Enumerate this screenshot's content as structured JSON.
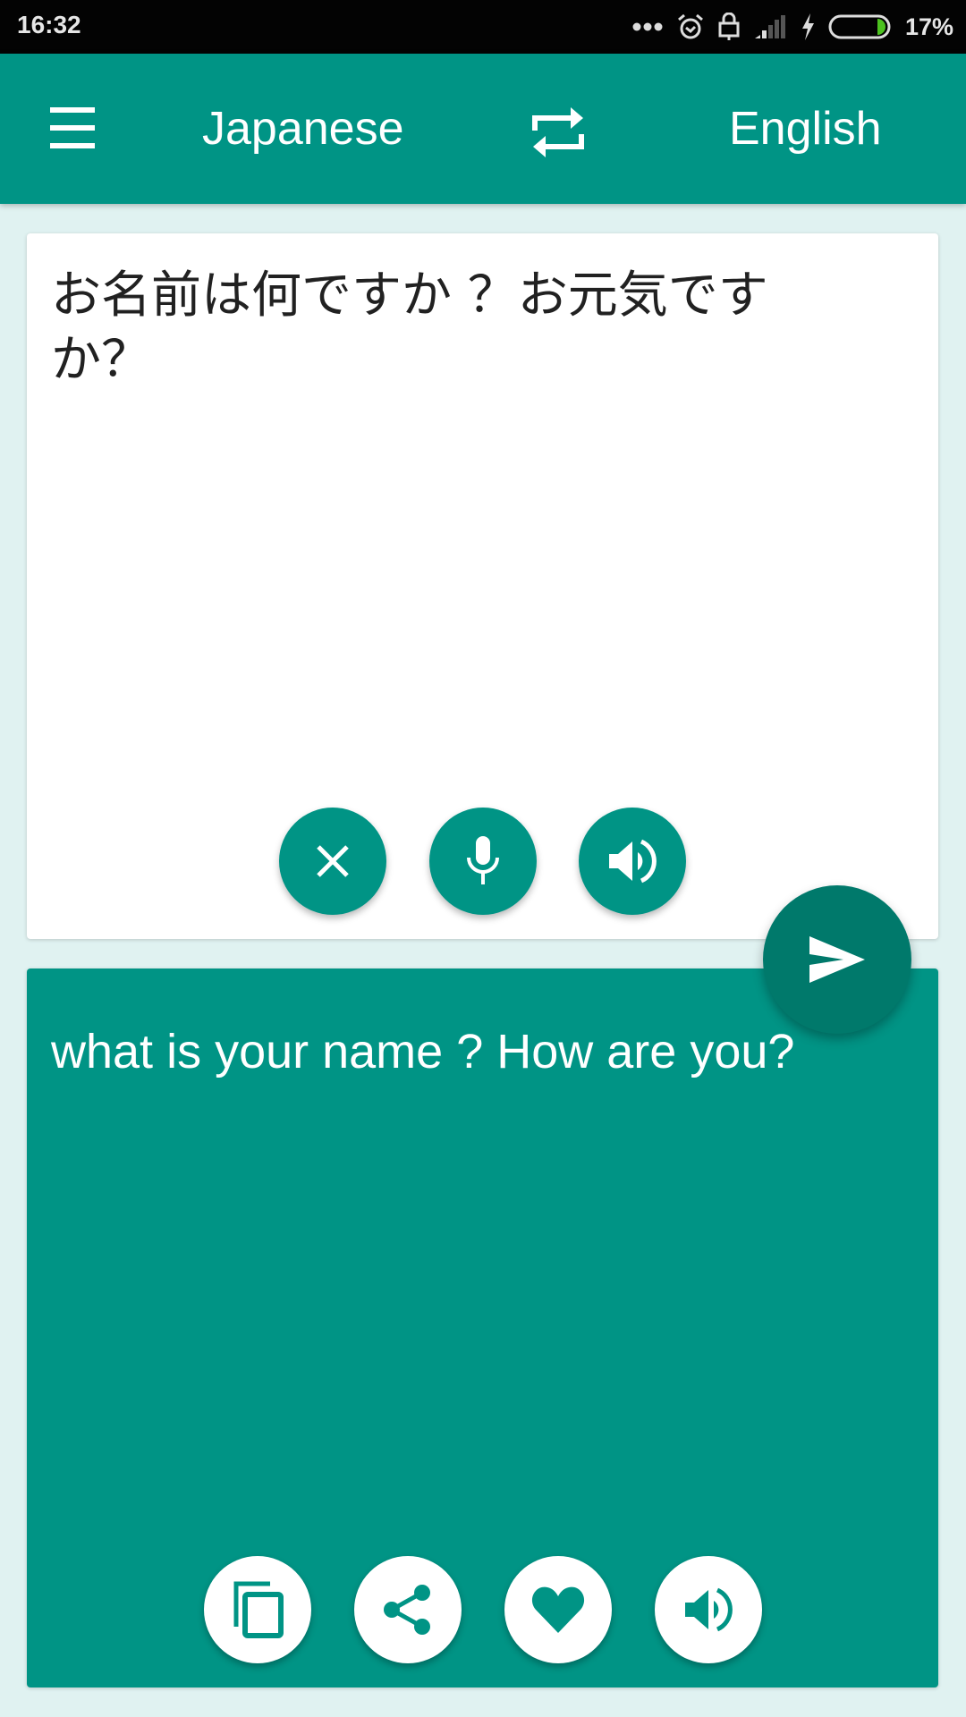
{
  "status_bar": {
    "time": "16:32",
    "battery_percent": "17%",
    "battery_level": 0.17,
    "icons": [
      "more-dots-icon",
      "alarm-icon",
      "lock-icon",
      "signal-icon",
      "charging-icon",
      "battery-icon"
    ]
  },
  "app_bar": {
    "menu_icon": "hamburger-menu-icon",
    "source_language": "Japanese",
    "swap_icon": "swap-languages-icon",
    "target_language": "English"
  },
  "input_card": {
    "text": "お名前は何ですか ？お元気ですか？",
    "actions": [
      {
        "name": "clear",
        "icon": "close-icon"
      },
      {
        "name": "voice-input",
        "icon": "microphone-icon"
      },
      {
        "name": "speak-source",
        "icon": "speaker-icon"
      }
    ]
  },
  "translate_button": {
    "icon": "send-icon"
  },
  "output_card": {
    "text": "what is your name ? How are you?",
    "actions": [
      {
        "name": "copy",
        "icon": "copy-icon"
      },
      {
        "name": "share",
        "icon": "share-icon"
      },
      {
        "name": "favorite",
        "icon": "heart-icon"
      },
      {
        "name": "speak-translation",
        "icon": "speaker-icon"
      }
    ]
  },
  "colors": {
    "primary": "#009485",
    "primary_dark": "#00796b",
    "background": "#e0f2f1",
    "battery_fill": "#4cc21f"
  }
}
